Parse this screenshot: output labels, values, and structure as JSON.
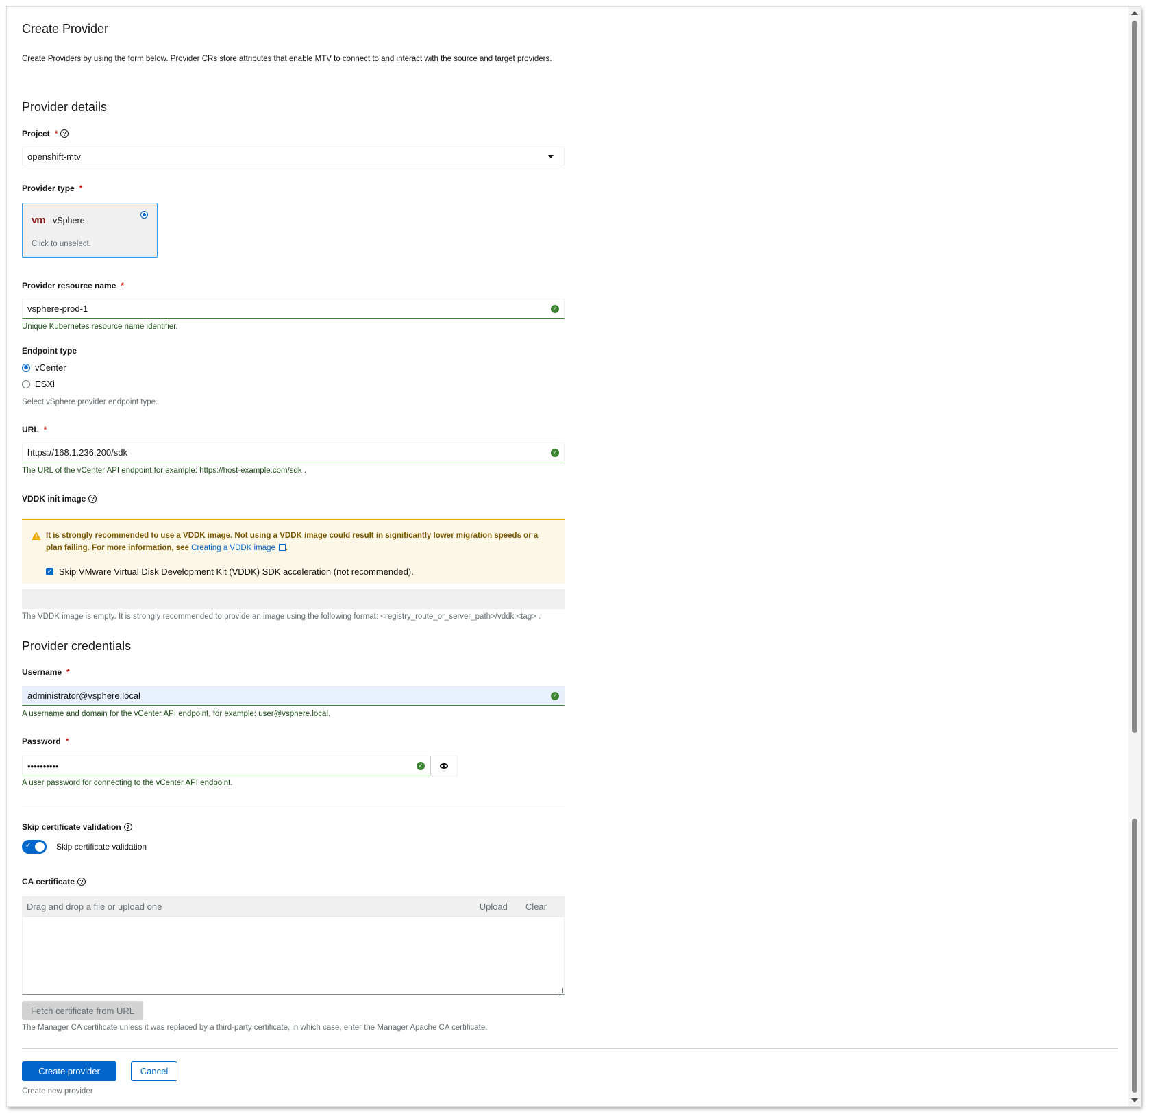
{
  "page": {
    "title": "Create Provider",
    "description": "Create Providers by using the form below. Provider CRs store attributes that enable MTV to connect to and interact with the source and target providers."
  },
  "provider_details": {
    "heading": "Provider details",
    "project": {
      "label": "Project",
      "value": "openshift-mtv"
    },
    "provider_type": {
      "label": "Provider type",
      "tile_logo": "vm",
      "tile_name": "vSphere",
      "tile_hint": "Click to unselect.",
      "selected": true
    },
    "resource_name": {
      "label": "Provider resource name",
      "value": "vsphere-prod-1",
      "helper": "Unique Kubernetes resource name identifier."
    },
    "endpoint_type": {
      "label": "Endpoint type",
      "options": [
        "vCenter",
        "ESXi"
      ],
      "selected": "vCenter",
      "helper": "Select vSphere provider endpoint type."
    },
    "url": {
      "label": "URL",
      "value": "https://168.1.236.200/sdk",
      "helper": "The URL of the vCenter API endpoint for example: https://host-example.com/sdk ."
    },
    "vddk": {
      "label": "VDDK init image",
      "warning_text": "It is strongly recommended to use a VDDK image. Not using a VDDK image could result in significantly lower migration speeds or a plan failing. For more information, see",
      "warning_link": "Creating a VDDK image",
      "warning_end": ".",
      "skip_checkbox_label": "Skip VMware Virtual Disk Development Kit (VDDK) SDK acceleration (not recommended).",
      "skip_checked": true,
      "image_value": "",
      "helper": "The VDDK image is empty. It is strongly recommended to provide an image using the following format: <registry_route_or_server_path>/vddk:<tag> ."
    }
  },
  "provider_credentials": {
    "heading": "Provider credentials",
    "username": {
      "label": "Username",
      "value": "administrator@vsphere.local",
      "helper": "A username and domain for the vCenter API endpoint, for example: user@vsphere.local."
    },
    "password": {
      "label": "Password",
      "value": "••••••••••",
      "helper": "A user password for connecting to the vCenter API endpoint."
    },
    "skip_cert": {
      "label": "Skip certificate validation",
      "toggle_label": "Skip certificate validation",
      "enabled": true
    },
    "ca_certificate": {
      "label": "CA certificate",
      "placeholder": "Drag and drop a file or upload one",
      "upload_label": "Upload",
      "clear_label": "Clear",
      "fetch_label": "Fetch certificate from URL",
      "helper": "The Manager CA certificate unless it was replaced by a third-party certificate, in which case, enter the Manager Apache CA certificate."
    }
  },
  "actions": {
    "create_label": "Create provider",
    "cancel_label": "Cancel",
    "helper": "Create new provider"
  },
  "colors": {
    "primary": "#0066cc",
    "success": "#3e8635",
    "warning": "#f0ab00",
    "danger": "#c9190b",
    "vmware_logo": "#8b1c1c"
  }
}
